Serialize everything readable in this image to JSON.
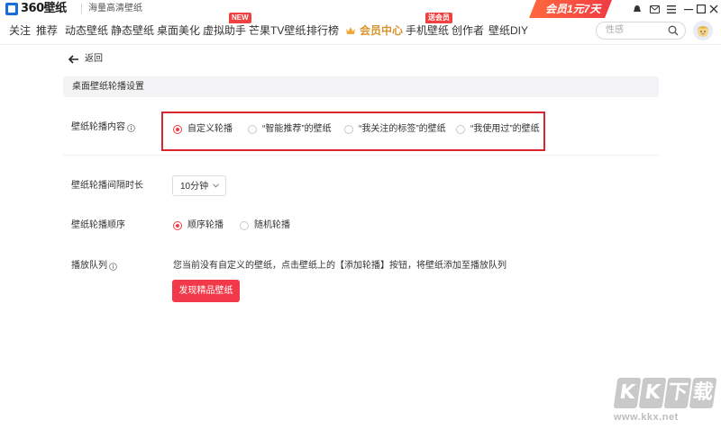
{
  "app": {
    "logo_text": "360壁纸",
    "slogan": "海量高清壁纸",
    "vip_banner": "会员1元7天"
  },
  "window_controls": {
    "icons": [
      "skin-icon",
      "mail-icon",
      "menu-icon",
      "minimize-icon",
      "maximize-icon",
      "close-icon"
    ]
  },
  "nav": {
    "items": [
      "关注",
      "推荐",
      "动态壁纸",
      "静态壁纸",
      "桌面美化",
      "虚拟助手",
      "芒果TV壁纸",
      "排行榜",
      "会员中心",
      "手机壁纸",
      "创作者",
      "壁纸DIY"
    ],
    "badges": {
      "new": "NEW",
      "vip": "送会员"
    },
    "search_placeholder": "性感"
  },
  "page": {
    "back_label": "返回",
    "section_title": "桌面壁纸轮播设置",
    "content_label": "壁纸轮播内容",
    "content_options": [
      "自定义轮播",
      "“智能推荐”的壁纸",
      "“我关注的标签”的壁纸",
      "“我使用过”的壁纸"
    ],
    "content_selected": 0,
    "interval_label": "壁纸轮播间隔时长",
    "interval_value": "10分钟",
    "order_label": "壁纸轮播顺序",
    "order_options": [
      "顺序轮播",
      "随机轮播"
    ],
    "order_selected": 0,
    "queue_label": "播放队列",
    "queue_message": "您当前没有自定义的壁纸，点击壁纸上的【添加轮播】按钮，将壁纸添加至播放队列",
    "discover_button": "发现精品壁纸"
  },
  "watermark": {
    "letters": [
      "K",
      "K",
      "下",
      "载"
    ],
    "url": "www.kkx.net"
  },
  "colors": {
    "accent": "#f2394a",
    "highlight_outline": "#d9262c",
    "vip_gold": "#d7942d",
    "logo_blue": "#1a6dd9"
  }
}
